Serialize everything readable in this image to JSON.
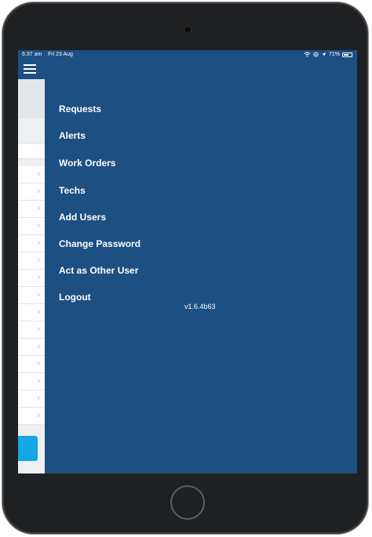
{
  "status_bar": {
    "time": "6:37 am",
    "date": "Fri 23 Aug",
    "battery": "71%",
    "battery_level": 0.71
  },
  "menu": {
    "items": [
      {
        "label": "Requests"
      },
      {
        "label": "Alerts"
      },
      {
        "label": "Work Orders"
      },
      {
        "label": "Techs"
      },
      {
        "label": "Add Users"
      },
      {
        "label": "Change Password"
      },
      {
        "label": "Act as Other User"
      },
      {
        "label": "Logout"
      }
    ],
    "version": "v1.6.4b63"
  },
  "icons": {
    "menu": "hamburger-icon",
    "wifi": "wifi-icon",
    "location": "location-icon",
    "battery": "battery-icon",
    "row_chevron": "chevron-right-icon"
  },
  "colors": {
    "drawer_bg": "#1c4f82",
    "accent_button": "#13a7e6",
    "menu_text": "#ffffff"
  }
}
